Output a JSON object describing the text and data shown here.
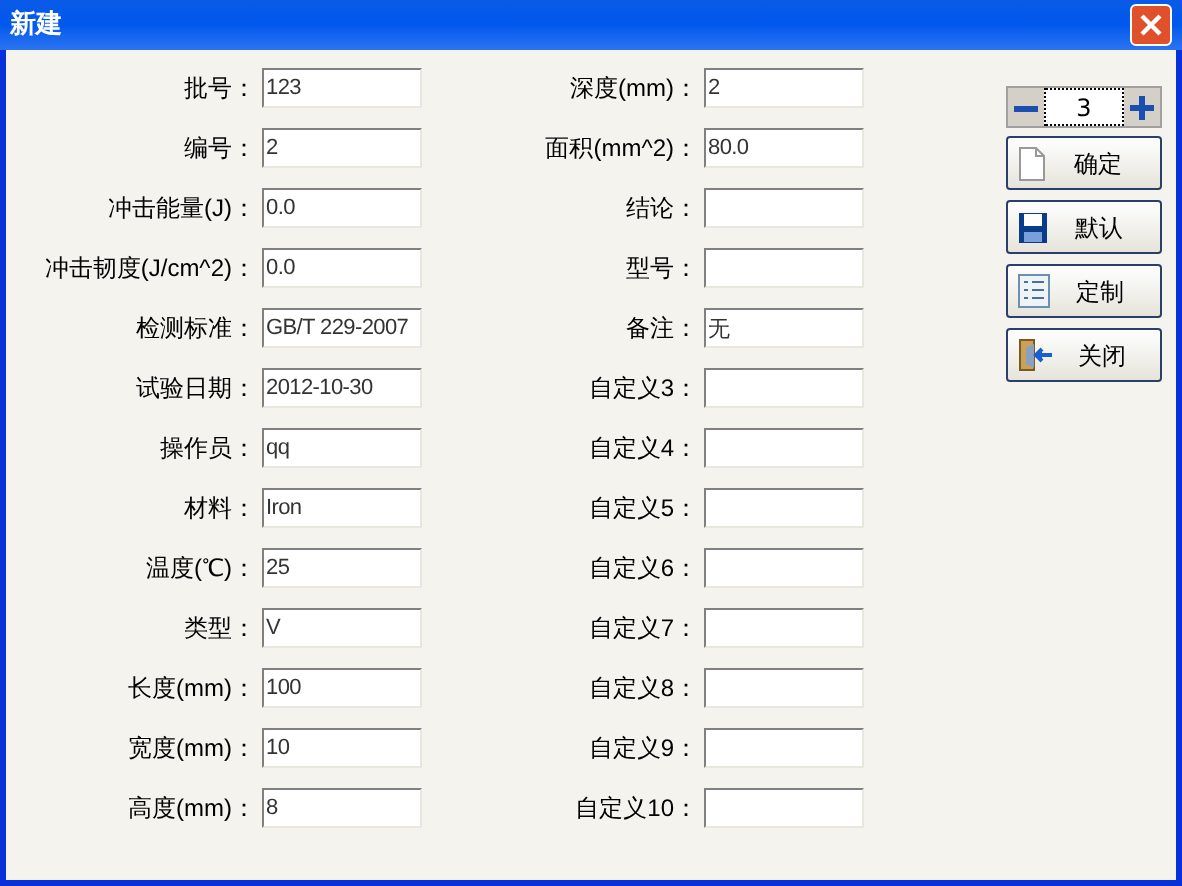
{
  "window": {
    "title": "新建"
  },
  "fields_left": [
    {
      "label": "批号：",
      "value": "123"
    },
    {
      "label": "编号：",
      "value": "2"
    },
    {
      "label": "冲击能量(J)：",
      "value": "0.0"
    },
    {
      "label": "冲击韧度(J/cm^2)：",
      "value": "0.0"
    },
    {
      "label": "检测标准：",
      "value": "GB/T 229-2007"
    },
    {
      "label": "试验日期：",
      "value": "2012-10-30"
    },
    {
      "label": "操作员：",
      "value": "qq"
    },
    {
      "label": "材料：",
      "value": "Iron"
    },
    {
      "label": "温度(℃)：",
      "value": "25"
    },
    {
      "label": "类型：",
      "value": "V"
    },
    {
      "label": "长度(mm)：",
      "value": "100"
    },
    {
      "label": "宽度(mm)：",
      "value": "10"
    },
    {
      "label": "高度(mm)：",
      "value": "8"
    }
  ],
  "fields_right": [
    {
      "label": "深度(mm)：",
      "value": "2"
    },
    {
      "label": "面积(mm^2)：",
      "value": "80.0"
    },
    {
      "label": "结论："
    },
    {
      "label": "型号："
    },
    {
      "label": "备注：",
      "value": "无"
    },
    {
      "label": "自定义3："
    },
    {
      "label": "自定义4："
    },
    {
      "label": "自定义5："
    },
    {
      "label": "自定义6："
    },
    {
      "label": "自定义7："
    },
    {
      "label": "自定义8："
    },
    {
      "label": "自定义9："
    },
    {
      "label": "自定义10："
    }
  ],
  "counter": {
    "value": "3"
  },
  "buttons": [
    "确定",
    "默认",
    "定制",
    "关闭"
  ]
}
